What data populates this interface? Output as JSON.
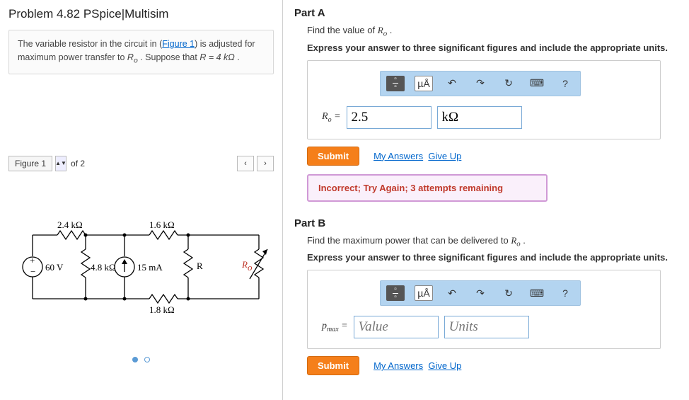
{
  "problem": {
    "title": "Problem 4.82 PSpice|Multisim",
    "prompt_prefix": "The variable resistor in the circuit in (",
    "figure_link": "Figure 1",
    "prompt_mid": ") is adjusted for maximum power transfer to ",
    "Ro_sym": "R",
    "Ro_sub": "o",
    "prompt_suffix1": " . Suppose that ",
    "R_eq": "R = 4 kΩ",
    "prompt_end": " ."
  },
  "figure_bar": {
    "label": "Figure 1",
    "of_text": "of 2",
    "prev": "‹",
    "next": "›"
  },
  "circuit": {
    "r1": "2.4 kΩ",
    "r2": "1.6 kΩ",
    "vsrc": "60 V",
    "r3": "4.8 kΩ",
    "isrc": "15 mA",
    "rR": "R",
    "rRo": "Ro",
    "r4": "1.8 kΩ"
  },
  "toolbar": {
    "mu": "µÅ",
    "undo": "↶",
    "redo": "↷",
    "reset": "↻",
    "keyboard": "⌨",
    "help": "?"
  },
  "partA": {
    "header": "Part A",
    "instr": "Find the value of ",
    "instr_sym": "R",
    "instr_sub": "o",
    "instr_end": " .",
    "bold": "Express your answer to three significant figures and include the appropriate units.",
    "prefix_sym": "R",
    "prefix_sub": "o",
    "eq": " = ",
    "value": "2.5",
    "units": "kΩ",
    "submit": "Submit",
    "myans": "My Answers",
    "giveup": "Give Up",
    "feedback": "Incorrect; Try Again; 3 attempts remaining"
  },
  "partB": {
    "header": "Part B",
    "instr": "Find the maximum power that can be delivered to ",
    "instr_sym": "R",
    "instr_sub": "o",
    "instr_end": " .",
    "bold": "Express your answer to three significant figures and include the appropriate units.",
    "prefix_sym": "p",
    "prefix_sub": "max",
    "eq": " = ",
    "value_ph": "Value",
    "units_ph": "Units",
    "submit": "Submit",
    "myans": "My Answers",
    "giveup": "Give Up"
  }
}
